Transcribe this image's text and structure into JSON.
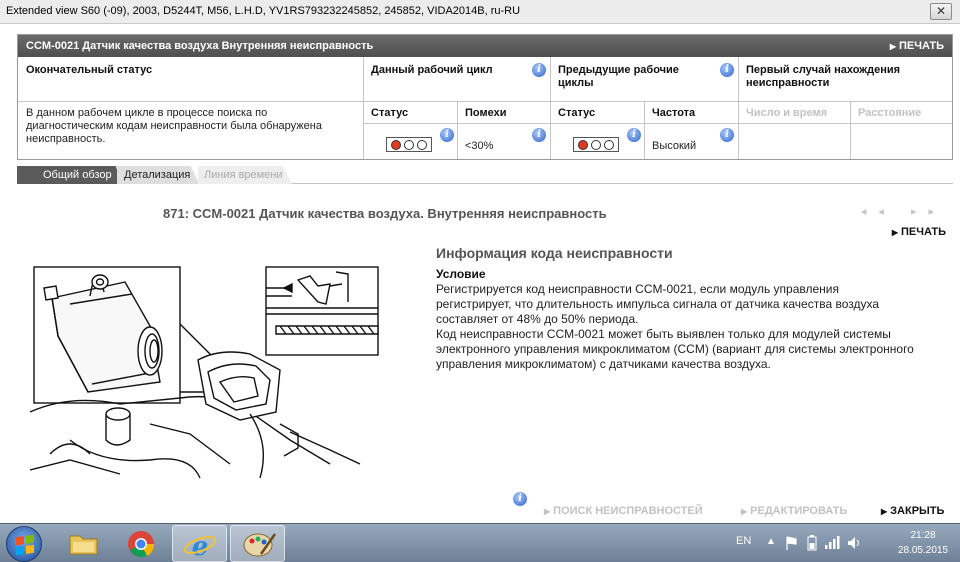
{
  "window": {
    "title": "Extended view   S60 (-09), 2003, D5244T, M56, L.H.D, YV1RS793232245852, 245852, VIDA2014B, ru-RU",
    "close_glyph": "✕"
  },
  "header": {
    "title": "CCM-0021 Датчик качества воздуха Внутренняя неисправность",
    "print_label": "ПЕЧАТЬ"
  },
  "status_table": {
    "final_status_label": "Окончательный статус",
    "current_cycle_label": "Данный рабочий цикл",
    "previous_cycles_label": "Предыдущие рабочие циклы",
    "first_occurrence_label": "Первый случай нахождения неисправности",
    "description": "В данном рабочем цикле в процессе поиска по диагностическим кодам неисправности была обнаружена неисправность.",
    "status_label_1": "Статус",
    "interference_label": "Помехи",
    "interference_value": "<30%",
    "status_label_2": "Статус",
    "frequency_label": "Частота",
    "frequency_value": "Высокий",
    "number_time_label": "Число и время",
    "distance_label": "Расстояние"
  },
  "tabs": [
    {
      "label": "Общий обзор"
    },
    {
      "label": "Детализация"
    },
    {
      "label": "Линия времени"
    }
  ],
  "main": {
    "title": "871: CCM-0021 Датчик качества воздуха. Внутренняя неисправность",
    "nav_arrows": "◂◂ ▸▸",
    "print_label": "ПЕЧАТЬ",
    "info_title": "Информация кода неисправности",
    "condition_title": "Условие",
    "condition_text": "Регистрируется код неисправности CCM-0021, если модуль управления регистрирует, что длительность импульса сигнала от датчика качества воздуха составляет от 48% до 50% периода.\nКод неисправности CCM-0021 может быть выявлен только для модулей системы электронного управления микроклиматом (CCM) (вариант для системы электронного управления микроклиматом) с датчиками качества воздуха."
  },
  "footer": {
    "troubleshoot_label": "ПОИСК НЕИСПРАВНОСТЕЙ",
    "edit_label": "РЕДАКТИРОВАТЬ",
    "close_label": "ЗАКРЫТЬ"
  },
  "taskbar": {
    "lang": "EN",
    "time": "21:28",
    "date": "28.05.2015"
  },
  "colors": {
    "header_bg": "#5a5a5a",
    "status_red": "#e03a20",
    "info_blue": "#2f62c4",
    "disabled_text": "#c2c2c2"
  }
}
